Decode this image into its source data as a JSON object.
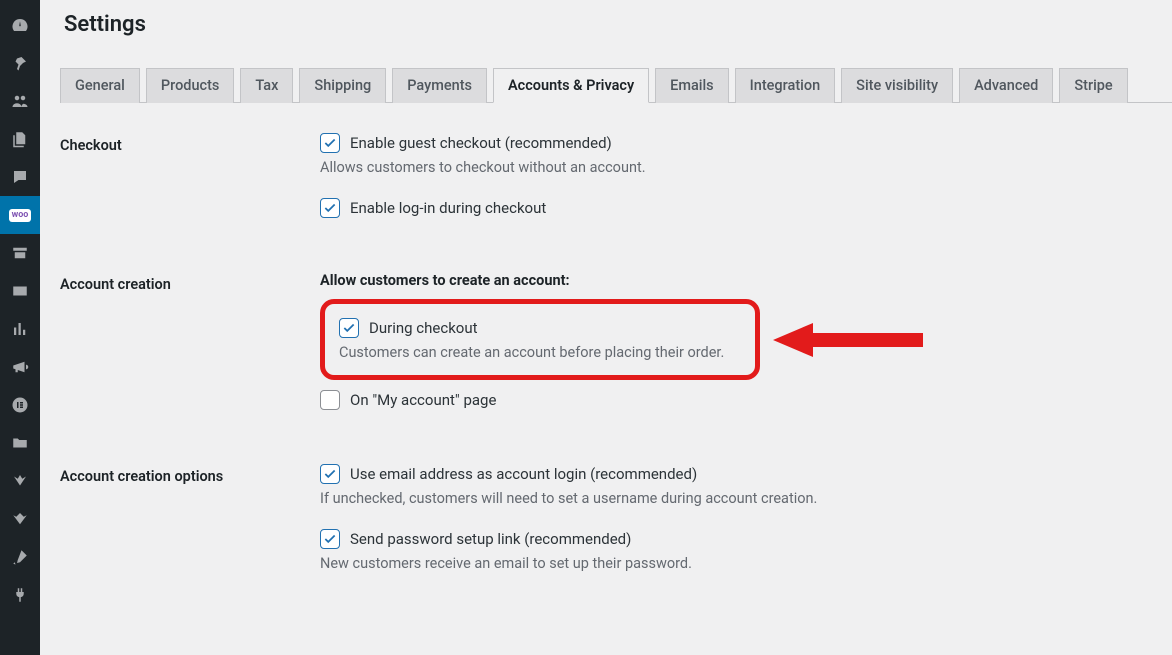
{
  "page": {
    "title": "Settings"
  },
  "tabs": {
    "general": "General",
    "products": "Products",
    "tax": "Tax",
    "shipping": "Shipping",
    "payments": "Payments",
    "accounts": "Accounts & Privacy",
    "emails": "Emails",
    "integration": "Integration",
    "visibility": "Site visibility",
    "advanced": "Advanced",
    "stripe": "Stripe"
  },
  "sections": {
    "checkout": {
      "label": "Checkout",
      "guest_checkout_label": "Enable guest checkout (recommended)",
      "guest_checkout_desc": "Allows customers to checkout without an account.",
      "login_label": "Enable log-in during checkout"
    },
    "account_creation": {
      "label": "Account creation",
      "heading": "Allow customers to create an account:",
      "during_checkout_label": "During checkout",
      "during_checkout_desc": "Customers can create an account before placing their order.",
      "my_account_label": "On \"My account\" page"
    },
    "account_creation_options": {
      "label": "Account creation options",
      "email_login_label": "Use email address as account login (recommended)",
      "email_login_desc": "If unchecked, customers will need to set a username during account creation.",
      "pwd_link_label": "Send password setup link (recommended)",
      "pwd_link_desc": "New customers receive an email to set up their password."
    }
  },
  "sidebar_icons": [
    "dashboard",
    "pin",
    "users",
    "pages",
    "comments",
    "woocommerce",
    "archive",
    "payments",
    "analytics",
    "marketing",
    "elementor",
    "folder",
    "wp1",
    "wp2",
    "brush",
    "tools"
  ],
  "colors": {
    "accent": "#2271b1",
    "highlight": "#e21b1b",
    "woo_active_bg": "#0073aa"
  }
}
